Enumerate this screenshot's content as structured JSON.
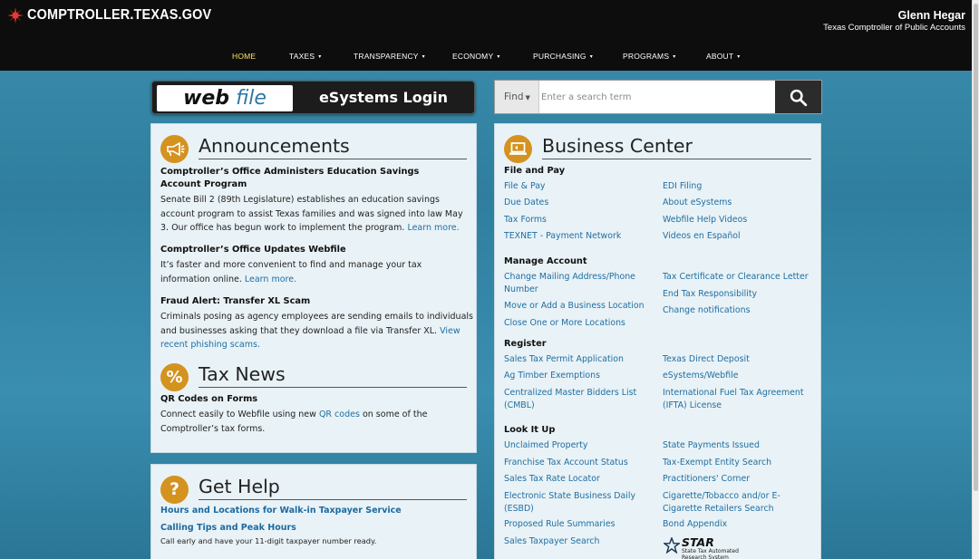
{
  "header": {
    "site_logo": "COMPTROLLER.TEXAS.GOV",
    "official_name": "Glenn Hegar",
    "official_title": "Texas Comptroller of Public Accounts"
  },
  "nav": [
    {
      "label": "HOME",
      "active": true
    },
    {
      "label": "TAXES",
      "caret": "▾"
    },
    {
      "label": "TRANSPARENCY",
      "caret": "▾"
    },
    {
      "label": "ECONOMY",
      "caret": "▾"
    },
    {
      "label": "PURCHASING",
      "caret": "▾"
    },
    {
      "label": "PROGRAMS",
      "caret": "▾"
    },
    {
      "label": "ABOUT",
      "caret": "▾"
    }
  ],
  "webfile": {
    "web": "web",
    "file": "file",
    "login_label": "eSystems Login"
  },
  "search": {
    "find_label": "Find",
    "placeholder": "Enter a search term"
  },
  "announcements": {
    "title": "Announcements",
    "items": [
      {
        "heading": "Comptroller’s Office Administers Education Savings Account Program",
        "body": "Senate Bill 2 (89th Legislature) establishes an education savings account program to assist Texas families and was signed into law May 3. Our office has begun work to implement the program.",
        "link": "Learn more."
      },
      {
        "heading": "Comptroller’s Office Updates Webfile",
        "body": "It’s faster and more convenient to find and manage your tax information online.",
        "link": "Learn more."
      },
      {
        "heading": "Fraud Alert: Transfer XL Scam",
        "body": "Criminals posing as agency employees are sending emails to individuals and businesses asking that they download a file via Transfer XL.",
        "link": "View recent phishing scams."
      }
    ]
  },
  "tax_news": {
    "title": "Tax News",
    "icon_text": "%",
    "heading": "QR Codes on Forms",
    "body_before": "Connect easily to Webfile using new",
    "link": "QR codes",
    "body_after": "on some of the Comptroller’s tax forms."
  },
  "get_help": {
    "title": "Get Help",
    "icon_text": "?",
    "link1": "Hours and Locations for Walk-in Taxpayer Service",
    "link2": "Calling Tips and Peak Hours",
    "note": "Call early and have your 11-digit taxpayer number ready."
  },
  "business_center": {
    "title": "Business Center",
    "file_and_pay": {
      "heading": "File and Pay",
      "left": [
        "File & Pay",
        "Due Dates",
        "Tax Forms",
        "TEXNET - Payment Network"
      ],
      "right": [
        "EDI Filing",
        "About eSystems",
        "Webfile Help Videos",
        "Videos en Español"
      ]
    },
    "manage_account": {
      "heading": "Manage Account",
      "left": [
        "Change Mailing Address/Phone Number",
        "Move or Add a Business Location",
        "Close One or More Locations"
      ],
      "right": [
        "Tax Certificate or Clearance Letter",
        "End Tax Responsibility",
        "Change notifications"
      ]
    },
    "register": {
      "heading": "Register",
      "left": [
        "Sales Tax Permit Application",
        "Ag Timber Exemptions",
        "Centralized Master Bidders List (CMBL)"
      ],
      "right": [
        "Texas Direct Deposit",
        "eSystems/Webfile",
        "International Fuel Tax Agreement (IFTA) License"
      ]
    },
    "look_it_up": {
      "heading": "Look It Up",
      "left": [
        "Unclaimed Property",
        "Franchise Tax Account Status",
        "Sales Tax Rate Locator",
        "Electronic State Business Daily (ESBD)",
        "Proposed Rule Summaries",
        "Sales Taxpayer Search"
      ],
      "right": [
        "State Payments Issued",
        "Tax-Exempt Entity Search",
        "Practitioners' Corner",
        "Cigarette/Tobacco and/or E-Cigarette Retailers Search",
        "Bond Appendix"
      ]
    },
    "star_logo": {
      "name": "STAR",
      "caption": "State Tax Automated Research System"
    }
  },
  "colors": {
    "accent_orange": "#d4921f",
    "link_blue": "#1f6fa3",
    "nav_active": "#ffe566"
  }
}
